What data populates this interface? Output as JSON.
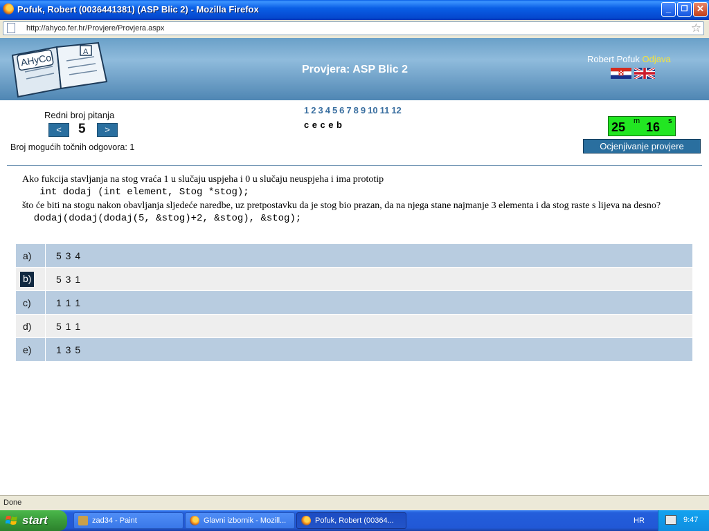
{
  "window": {
    "title": "Pofuk, Robert (0036441381) (ASP Blic 2) - Mozilla Firefox",
    "minimize": "_",
    "restore": "❐",
    "close": "✕"
  },
  "address_bar": {
    "url": "http://ahyco.fer.hr/Provjere/Provjera.aspx"
  },
  "header": {
    "logo_text": "AHyCo",
    "test_title": "Provjera: ASP Blic 2",
    "user_name": "Robert Pofuk",
    "logout_label": "Odjava"
  },
  "navigation": {
    "label": "Redni broj pitanja",
    "prev": "<",
    "next": ">",
    "current": "5",
    "answers_count": "Broj mogućih točnih odgovora: 1"
  },
  "question_list": [
    "1",
    "2",
    "3",
    "4",
    "5",
    "6",
    "7",
    "8",
    "9",
    "10",
    "11",
    "12"
  ],
  "answer_marks": [
    "c",
    "e",
    "c",
    "e",
    "b"
  ],
  "timer": {
    "minutes": "25",
    "min_unit": "m",
    "seconds": "16",
    "sec_unit": "s"
  },
  "grade_button": "Ocjenjivanje provjere",
  "question": {
    "line1": "Ako fukcija stavljanja na stog vraća 1 u slučaju uspjeha i 0 u slučaju neuspjeha i ima prototip",
    "code1": "   int dodaj (int element, Stog *stog);",
    "line2": "što će biti na stogu nakon obavljanja sljedeće naredbe, uz pretpostavku da je stog bio prazan, da na njega stane najmanje 3 elementa i da stog raste s lijeva na desno?",
    "code2": "  dodaj(dodaj(dodaj(5, &stog)+2, &stog), &stog);"
  },
  "choices": [
    {
      "letter": "a)",
      "text": "5 3 4"
    },
    {
      "letter": "b)",
      "text": "5 3 1"
    },
    {
      "letter": "c)",
      "text": "1 1 1"
    },
    {
      "letter": "d)",
      "text": "5 1 1"
    },
    {
      "letter": "e)",
      "text": "1 3 5"
    }
  ],
  "selected_choice": "b)",
  "status": "Done",
  "taskbar": {
    "start": "start",
    "tasks": [
      "zad34 - Paint",
      "Glavni izbornik - Mozill...",
      "Pofuk, Robert (00364..."
    ],
    "language": "HR",
    "clock": "9:47"
  },
  "colors": {
    "header_blue": "#6aa0c8",
    "button_blue": "#2a6f9f",
    "timer_green": "#22e622",
    "choice_blue": "#b8cce0",
    "choice_gray": "#eeeeee",
    "logout_yellow": "#f5e23a"
  },
  "icons": [
    "firefox-icon",
    "page-icon",
    "bookmark-star-icon",
    "croatian-flag-icon",
    "uk-flag-icon",
    "windows-logo-icon",
    "paint-icon",
    "tray-network-icon"
  ]
}
